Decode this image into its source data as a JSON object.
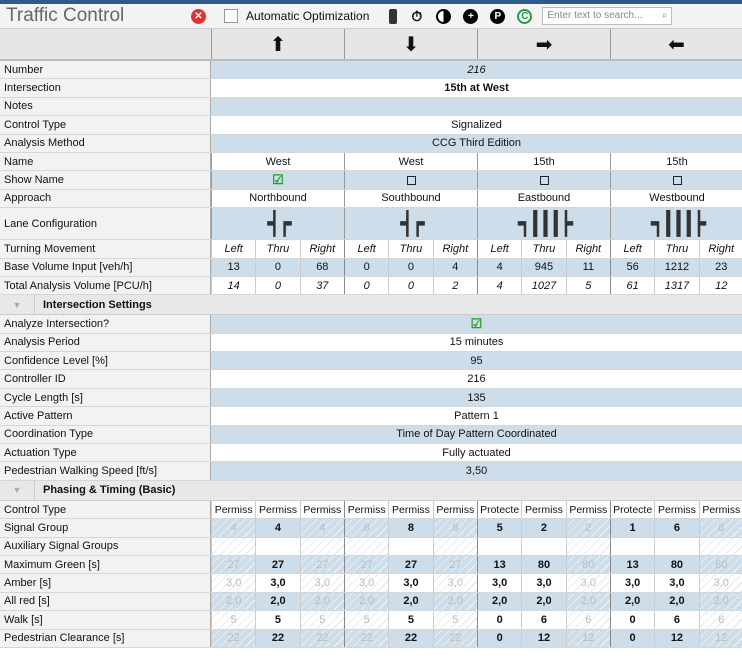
{
  "window": {
    "title": "Traffic Control"
  },
  "toolbar": {
    "auto_opt_label": "Automatic Optimization",
    "auto_opt_checked": false,
    "search_placeholder": "Enter text to search...",
    "icons": [
      "close-red-icon",
      "signal-icon",
      "stopwatch-icon",
      "pie-icon",
      "plus-icon",
      "p-icon",
      "c-icon"
    ]
  },
  "approach_arrows": [
    "⬆",
    "⬇",
    "➡",
    "⬅"
  ],
  "general": [
    {
      "label": "Number",
      "value": "216",
      "style": "italic"
    },
    {
      "label": "Intersection",
      "value": "15th at West",
      "style": "bold"
    },
    {
      "label": "Notes",
      "value": ""
    },
    {
      "label": "Control Type",
      "value": "Signalized"
    },
    {
      "label": "Analysis Method",
      "value": "CCG Third Edition"
    }
  ],
  "approaches": {
    "name_label": "Name",
    "names": [
      "West",
      "West",
      "15th",
      "15th"
    ],
    "show_name_label": "Show Name",
    "show_name": [
      true,
      false,
      false,
      false
    ],
    "approach_label": "Approach",
    "approaches": [
      "Northbound",
      "Southbound",
      "Eastbound",
      "Westbound"
    ],
    "lane_label": "Lane Configuration",
    "lanes": [
      "┥┍",
      "┥┍",
      "┑┃┃┃┝",
      "┑┃┃┃┝"
    ],
    "turn_label": "Turning Movement",
    "turns": [
      "Left",
      "Thru",
      "Right",
      "Left",
      "Thru",
      "Right",
      "Left",
      "Thru",
      "Right",
      "Left",
      "Thru",
      "Right"
    ],
    "base_label": "Base Volume Input [veh/h]",
    "base": [
      "13",
      "0",
      "68",
      "0",
      "0",
      "4",
      "4",
      "945",
      "11",
      "56",
      "1212",
      "23"
    ],
    "total_label": "Total Analysis Volume [PCU/h]",
    "total": [
      "14",
      "0",
      "37",
      "0",
      "0",
      "2",
      "4",
      "1027",
      "5",
      "61",
      "1317",
      "12"
    ]
  },
  "intersection_settings": {
    "title": "Intersection Settings",
    "rows": [
      {
        "label": "Analyze Intersection?",
        "value": "☑"
      },
      {
        "label": "Analysis Period",
        "value": "15 minutes"
      },
      {
        "label": "Confidence Level [%]",
        "value": "95"
      },
      {
        "label": "Controller ID",
        "value": "216"
      },
      {
        "label": "Cycle Length [s]",
        "value": "135"
      },
      {
        "label": "Active Pattern",
        "value": "Pattern 1"
      },
      {
        "label": "Coordination Type",
        "value": "Time of Day Pattern Coordinated"
      },
      {
        "label": "Actuation Type",
        "value": "Fully actuated"
      },
      {
        "label": "Pedestrian Walking Speed [ft/s]",
        "value": "3,50"
      }
    ]
  },
  "phasing": {
    "title": "Phasing & Timing (Basic)",
    "active": [
      false,
      true,
      false,
      false,
      true,
      false,
      true,
      true,
      false,
      true,
      true,
      false
    ],
    "rows": [
      {
        "label": "Control Type",
        "values": [
          "Permiss",
          "Permiss",
          "Permiss",
          "Permiss",
          "Permiss",
          "Permiss",
          "Protecte",
          "Permiss",
          "Permiss",
          "Protecte",
          "Permiss",
          "Permiss"
        ],
        "plain": true
      },
      {
        "label": "Signal Group",
        "values": [
          "4",
          "4",
          "4",
          "8",
          "8",
          "8",
          "5",
          "2",
          "2",
          "1",
          "6",
          "6"
        ]
      },
      {
        "label": "Auxiliary Signal Groups",
        "values": [
          "",
          "",
          "",
          "",
          "",
          "",
          "",
          "",
          "",
          "",
          "",
          ""
        ]
      },
      {
        "label": "Maximum Green [s]",
        "values": [
          "27",
          "27",
          "27",
          "27",
          "27",
          "27",
          "13",
          "80",
          "80",
          "13",
          "80",
          "80"
        ]
      },
      {
        "label": "Amber [s]",
        "values": [
          "3,0",
          "3,0",
          "3,0",
          "3,0",
          "3,0",
          "3,0",
          "3,0",
          "3,0",
          "3,0",
          "3,0",
          "3,0",
          "3,0"
        ]
      },
      {
        "label": "All red [s]",
        "values": [
          "2,0",
          "2,0",
          "2,0",
          "2,0",
          "2,0",
          "2,0",
          "2,0",
          "2,0",
          "2,0",
          "2,0",
          "2,0",
          "2,0"
        ]
      },
      {
        "label": "Walk [s]",
        "values": [
          "5",
          "5",
          "5",
          "5",
          "5",
          "5",
          "0",
          "6",
          "6",
          "0",
          "6",
          "6"
        ]
      },
      {
        "label": "Pedestrian Clearance [s]",
        "values": [
          "22",
          "22",
          "22",
          "22",
          "22",
          "22",
          "0",
          "12",
          "12",
          "0",
          "12",
          "12"
        ]
      }
    ]
  }
}
